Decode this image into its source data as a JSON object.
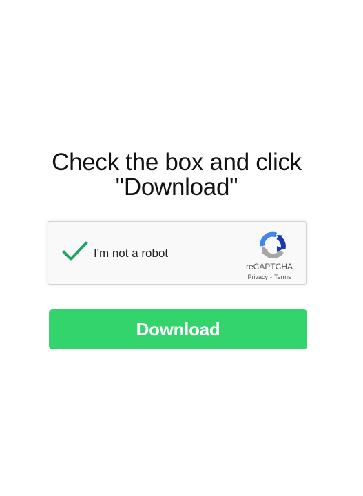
{
  "heading": {
    "line1": "Check the box and click",
    "line2": "\"Download\""
  },
  "recaptcha": {
    "checked": true,
    "label": "I'm not a robot",
    "brand": "reCAPTCHA",
    "privacy_link": "Privacy",
    "separator": "-",
    "terms_link": "Terms",
    "check_icon": "checkmark-icon",
    "logo_icon": "recaptcha-logo-icon",
    "colors": {
      "check": "#1ea362",
      "logo_blue": "#1c3aa9",
      "logo_light_blue": "#4285f4",
      "logo_gray": "#a6a6a6"
    }
  },
  "download": {
    "label": "Download",
    "color": "#33d46b"
  }
}
